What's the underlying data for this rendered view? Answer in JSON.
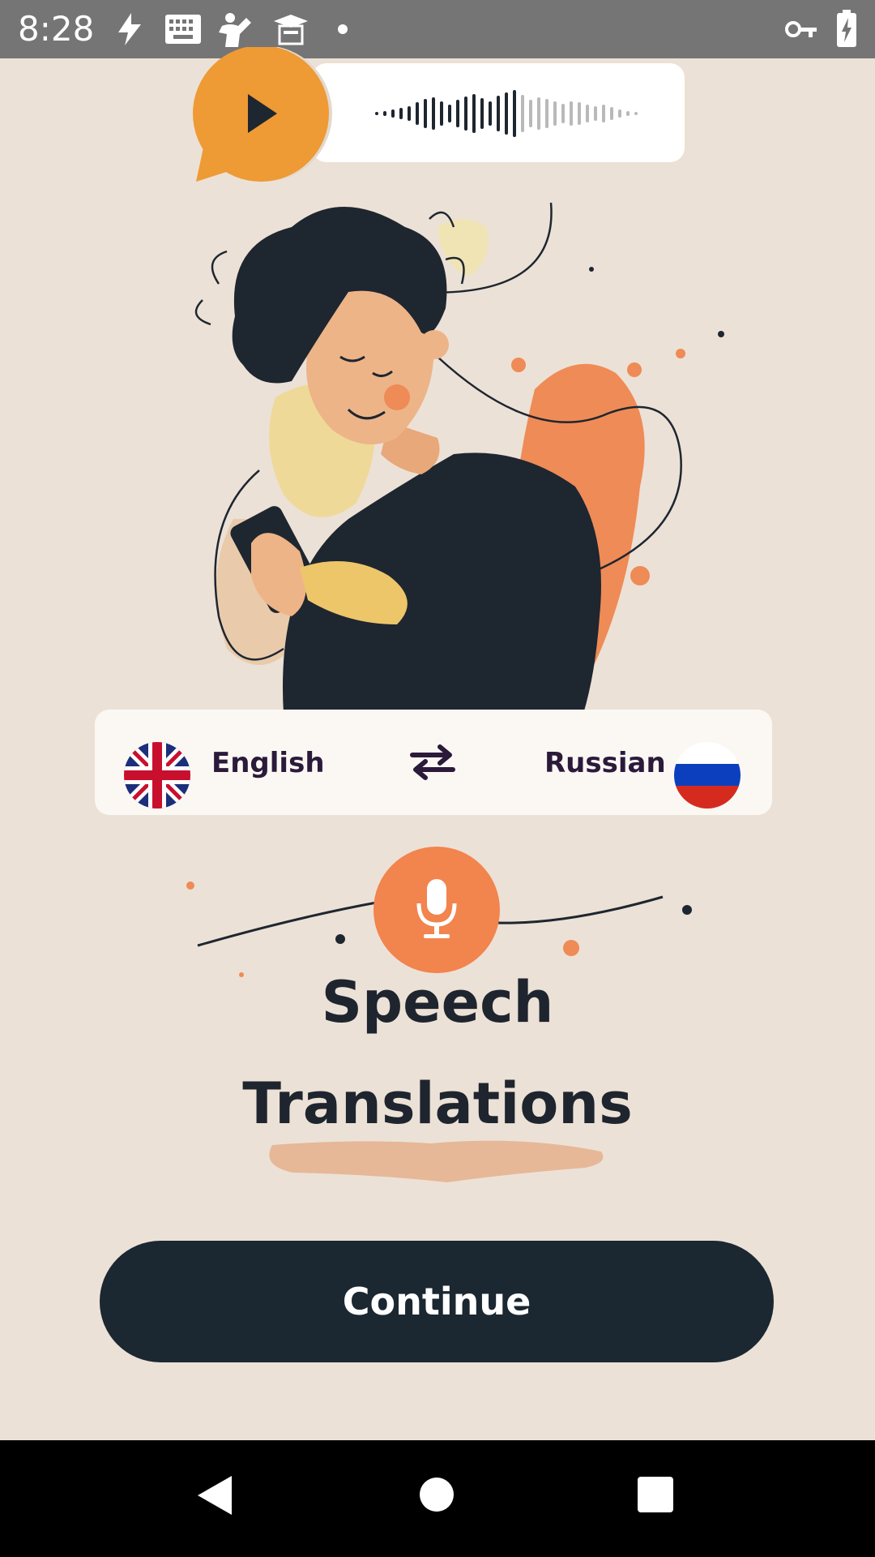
{
  "status_bar": {
    "time": "8:28",
    "icons": [
      "flash-icon",
      "keyboard-icon",
      "fitness-icon",
      "graduation-icon",
      "dot-icon",
      "vpn-key-icon",
      "battery-charging-icon"
    ]
  },
  "audio_card": {
    "play_icon": "play-icon",
    "waveform_icon": "waveform-icon"
  },
  "language_bar": {
    "source_language": "English",
    "target_language": "Russian",
    "source_flag": "uk-flag-icon",
    "target_flag": "russia-flag-icon",
    "swap_icon": "swap-arrows-icon"
  },
  "mic_icon": "microphone-icon",
  "title_line_1": "Speech",
  "title_line_2": "Translations",
  "continue_label": "Continue",
  "nav_bar": {
    "back_icon": "back-triangle-icon",
    "home_icon": "home-circle-icon",
    "recents_icon": "recents-square-icon"
  },
  "colors": {
    "background": "#ece1d6",
    "accent_orange": "#f2844d",
    "play_orange": "#ee9a35",
    "dark": "#1b2731",
    "card": "#fbf8f4"
  }
}
